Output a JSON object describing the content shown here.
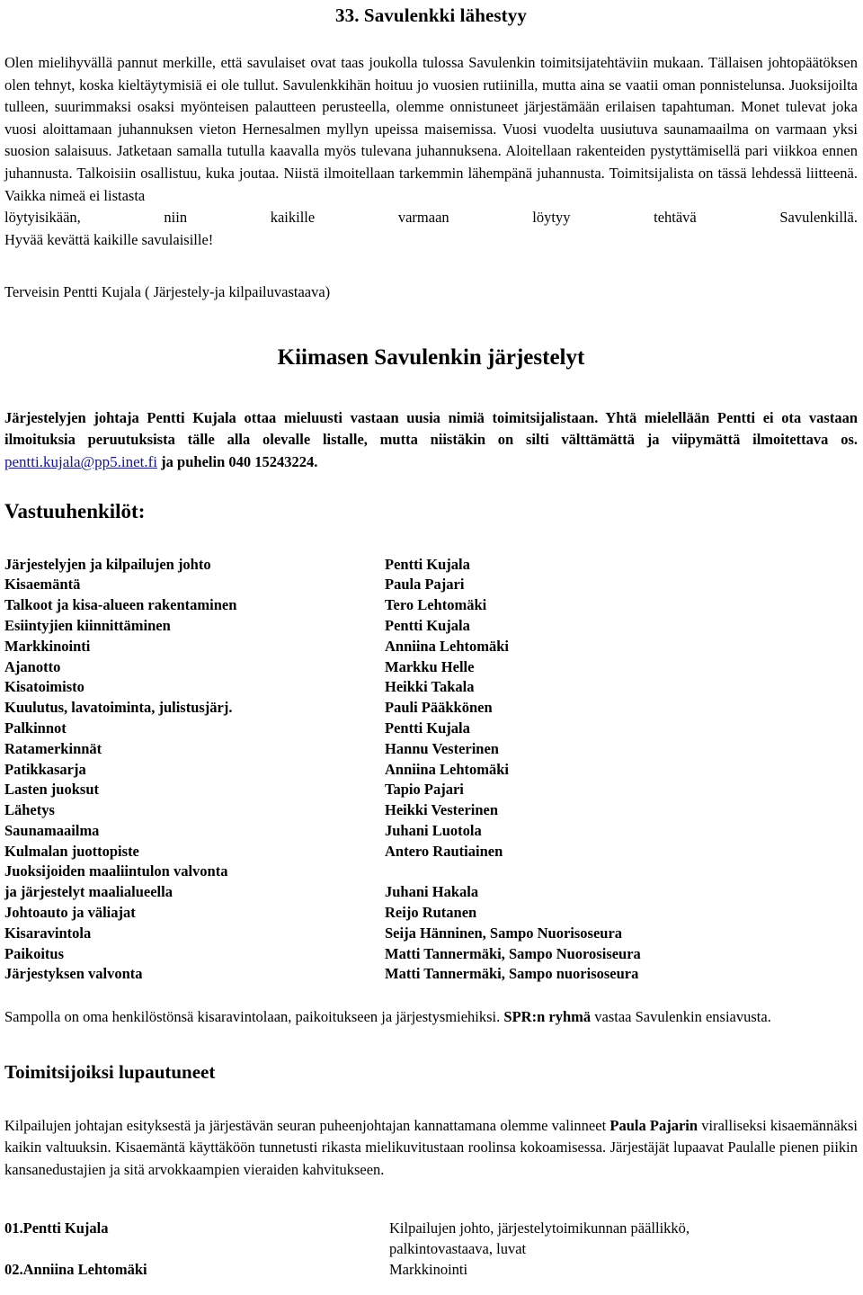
{
  "document": {
    "title": "33. Savulenkki lähestyy",
    "intro_paragraph": "Olen mielihyvällä pannut merkille, että savulaiset ovat taas joukolla tulossa Savulenkin toimitsijatehtäviin mukaan. Tällaisen johtopäätöksen olen tehnyt, koska kieltäytymisiä ei ole tullut. Savulenkkihän hoituu jo vuosien rutiinilla, mutta aina se vaatii oman ponnistelunsa. Juoksijoilta tulleen, suurimmaksi osaksi myönteisen palautteen perusteella, olemme onnistuneet järjestämään erilaisen tapahtuman. Monet tulevat joka vuosi aloittamaan juhannuksen vieton Hernesalmen myllyn upeissa maisemissa. Vuosi vuodelta uusiutuva saunamaailma on varmaan yksi suosion salaisuus. Jatketaan samalla tutulla kaavalla myös tulevana juhannuksena. Aloitellaan rakenteiden pystyttämisellä pari viikkoa ennen juhannusta. Talkoisiin osallistuu, kuka joutaa. Niistä ilmoitellaan tarkemmin lähempänä juhannusta. Toimitsijalista on tässä lehdessä liitteenä. Vaikka nimeä ei listasta",
    "intro_last_line": "löytyisikään, niin kaikille varmaan löytyy tehtävä Savulenkillä.",
    "intro_closing": "Hyvää kevättä kaikille savulaisille!",
    "signature": "Terveisin Pentti Kujala ( Järjestely-ja kilpailuvastaava)",
    "arrangements_heading": "Kiimasen Savulenkin järjestelyt",
    "arrangements_paragraph_before_email": "Järjestelyjen johtaja Pentti Kujala ottaa mieluusti vastaan uusia nimiä toimitsijalistaan. Yhtä mielellään Pentti ei ota vastaan ilmoituksia peruutuksista tälle alla olevalle listalle, mutta niistäkin on silti välttämättä ja viipymättä ilmoitettava os. ",
    "email": "pentti.kujala@pp5.inet.fi",
    "arrangements_paragraph_after_email": " ja puhelin 040 15243224.",
    "responsible_heading": "Vastuuhenkilöt:",
    "responsible_rows": [
      {
        "role": "Järjestelyjen ja kilpailujen johto",
        "person": "Pentti Kujala"
      },
      {
        "role": "Kisaemäntä",
        "person": "Paula Pajari"
      },
      {
        "role": "Talkoot ja kisa-alueen rakentaminen",
        "person": "Tero Lehtomäki"
      },
      {
        "role": "Esiintyjien kiinnittäminen",
        "person": "Pentti Kujala"
      },
      {
        "role": "Markkinointi",
        "person": "Anniina Lehtomäki"
      },
      {
        "role": "Ajanotto",
        "person": "Markku Helle"
      },
      {
        "role": "Kisatoimisto",
        "person": "Heikki Takala"
      },
      {
        "role": "Kuulutus, lavatoiminta, julistusjärj.",
        "person": "Pauli Pääkkönen"
      },
      {
        "role": "Palkinnot",
        "person": "Pentti Kujala"
      },
      {
        "role": "Ratamerkinnät",
        "person": "Hannu Vesterinen"
      },
      {
        "role": "Patikkasarja",
        "person": "Anniina Lehtomäki"
      },
      {
        "role": "Lasten juoksut",
        "person": "Tapio Pajari"
      },
      {
        "role": "Lähetys",
        "person": "Heikki Vesterinen"
      },
      {
        "role": "Saunamaailma",
        "person": "Juhani Luotola"
      },
      {
        "role": "Kulmalan juottopiste",
        "person": "Antero Rautiainen"
      },
      {
        "role": "Juoksijoiden maaliintulon valvonta",
        "person": ""
      },
      {
        "role": "ja järjestelyt maalialueella",
        "person": "Juhani Hakala"
      },
      {
        "role": "Johtoauto ja väliajat",
        "person": "Reijo Rutanen"
      },
      {
        "role": "Kisaravintola",
        "person": "Seija Hänninen, Sampo Nuorisoseura"
      },
      {
        "role": "Paikoitus",
        "person": "Matti Tannermäki, Sampo Nuorosiseura"
      },
      {
        "role": "Järjestyksen valvonta",
        "person": "Matti Tannermäki, Sampo nuorisoseura"
      }
    ],
    "sampo_note_part1": "Sampolla on oma henkilöstönsä kisaravintolaan, paikoitukseen ja järjestysmiehiksi. ",
    "sampo_note_bold": "SPR:n ryhmä",
    "sampo_note_part2": " vastaa Savulenkin ensiavusta.",
    "volunteers_heading": "Toimitsijoiksi lupautuneet",
    "volunteers_paragraph_part1": "Kilpailujen johtajan esityksestä ja järjestävän seuran puheenjohtajan kannattamana olemme valinneet ",
    "volunteers_paragraph_bold": "Paula Pajarin",
    "volunteers_paragraph_part2": " viralliseksi kisaemännäksi kaikin valtuuksin. Kisaemäntä käyttäköön tunnetusti rikasta mielikuvitustaan roolinsa kokoamisessa. Järjestäjät lupaavat Paulalle pienen piikin kansanedustajien ja sitä arvokkaampien vieraiden kahvitukseen.",
    "volunteer_rows": [
      {
        "num_name": "01.Pentti Kujala",
        "duties": [
          "Kilpailujen johto, järjestelytoimikunnan päällikkö,",
          "palkintovastaava,  luvat"
        ]
      },
      {
        "num_name": "02.Anniina Lehtomäki",
        "duties": [
          "Markkinointi"
        ]
      }
    ]
  },
  "colors": {
    "text": "#000000",
    "link": "#151585",
    "background": "#ffffff"
  }
}
